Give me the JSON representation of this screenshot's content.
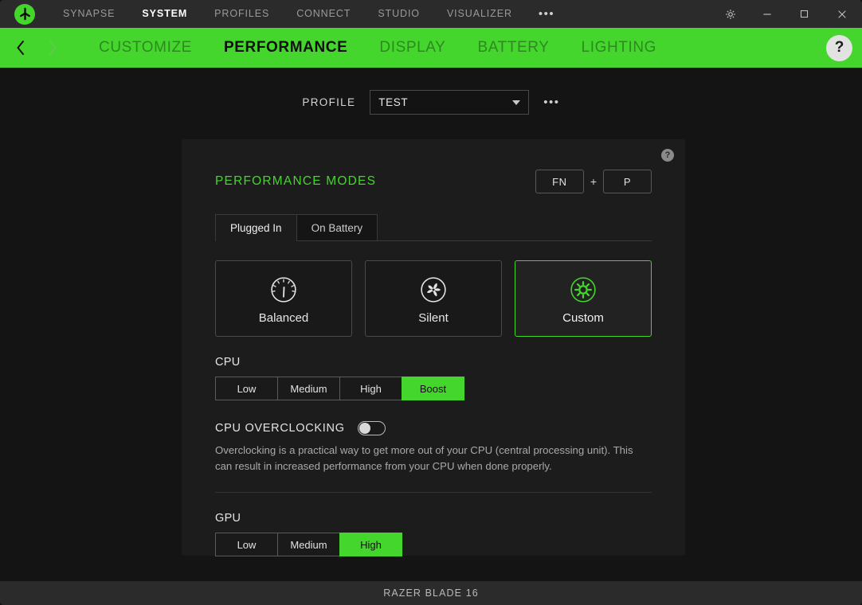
{
  "titlebar": {
    "logo_icon": "razer-logo-icon",
    "tabs": [
      {
        "label": "SYNAPSE",
        "active": false
      },
      {
        "label": "SYSTEM",
        "active": true
      },
      {
        "label": "PROFILES",
        "active": false
      },
      {
        "label": "CONNECT",
        "active": false
      },
      {
        "label": "STUDIO",
        "active": false
      },
      {
        "label": "VISUALIZER",
        "active": false
      }
    ],
    "overflow_label": "•••",
    "window_controls": [
      {
        "name": "settings-gear-icon",
        "glyph": "gear"
      },
      {
        "name": "minimize-icon",
        "glyph": "minimize"
      },
      {
        "name": "maximize-icon",
        "glyph": "maximize"
      },
      {
        "name": "close-icon",
        "glyph": "close"
      }
    ]
  },
  "subnav": {
    "back_icon": "chevron-left-icon",
    "forward_icon": "chevron-right-icon",
    "items": [
      {
        "label": "CUSTOMIZE",
        "active": false
      },
      {
        "label": "PERFORMANCE",
        "active": true
      },
      {
        "label": "DISPLAY",
        "active": false
      },
      {
        "label": "BATTERY",
        "active": false
      },
      {
        "label": "LIGHTING",
        "active": false
      }
    ],
    "help_label": "?",
    "accent_color": "#44d62c"
  },
  "profile": {
    "label": "PROFILE",
    "selected": "TEST",
    "more_label": "•••"
  },
  "card": {
    "help_label": "?",
    "title": "PERFORMANCE MODES",
    "shortcut": {
      "key1": "FN",
      "plus": "+",
      "key2": "P"
    },
    "tabs": [
      {
        "label": "Plugged In",
        "active": true
      },
      {
        "label": "On Battery",
        "active": false
      }
    ],
    "modes": [
      {
        "label": "Balanced",
        "icon": "gauge-icon",
        "selected": false
      },
      {
        "label": "Silent",
        "icon": "fan-icon",
        "selected": false
      },
      {
        "label": "Custom",
        "icon": "gear-circle-icon",
        "selected": true
      }
    ],
    "cpu": {
      "title": "CPU",
      "options": [
        {
          "label": "Low",
          "selected": false
        },
        {
          "label": "Medium",
          "selected": false
        },
        {
          "label": "High",
          "selected": false
        },
        {
          "label": "Boost",
          "selected": true
        }
      ]
    },
    "overclocking": {
      "title": "CPU OVERCLOCKING",
      "enabled": false,
      "description": "Overclocking is a practical way to get more out of your CPU (central processing unit). This can result in increased performance from your CPU when done properly."
    },
    "gpu": {
      "title": "GPU",
      "options": [
        {
          "label": "Low",
          "selected": false
        },
        {
          "label": "Medium",
          "selected": false
        },
        {
          "label": "High",
          "selected": true
        }
      ]
    }
  },
  "footer": {
    "device": "RAZER BLADE 16"
  }
}
